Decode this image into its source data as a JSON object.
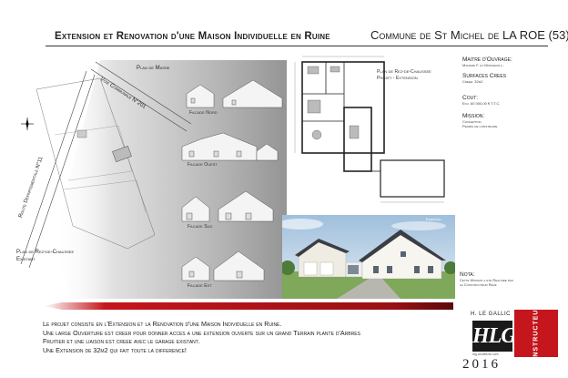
{
  "header": {
    "title": "Extension et Renovation d'une Maison Individuelle en Ruine",
    "commune": "Commune de St Michel de LA ROE (53)"
  },
  "site_plan": {
    "plan_label": "Plan de Masse",
    "road_1": "Voie Communale N°201",
    "road_2": "Route Departementale N°11",
    "existing_label": "Plan de Rez-de-Chaussee Existant"
  },
  "facades": {
    "nord": "Facade Nord",
    "ouest": "Facade Ouest",
    "sud": "Facade Sud",
    "est": "Facade Est"
  },
  "floor_plan": {
    "label_1": "Plan de Rez-de-Chaussee",
    "label_2": "Projet - Extension"
  },
  "insertion": {
    "label": "Insertion"
  },
  "sidebar": {
    "maitre_title": "Maitre d'Ouvrage:",
    "maitre_value": "Madame F. et Monsieur L.",
    "surfaces_title": "Surfaces Crees",
    "surfaces_value": "Creee: 32m2",
    "cout_title": "Cout:",
    "cout_value": "Env. 60 000,00 € T.T.C.",
    "mission_title": "Mission:",
    "mission_value_1": "Conception",
    "mission_value_2": "Permis de construire"
  },
  "nota": {
    "title": "Nota:",
    "text_1": "Cette Mission a ete Realisee par",
    "text_2": "le Constructeur Reve"
  },
  "description": {
    "line_1": "Le projet consiste en l'Extension et la Renovation d'une Maison Individuelle en Ruine.",
    "line_2": "Une large Ouverture est creer pour donner acces a une extension ouverte sur un grand Terrain plante d'Arbres",
    "line_3": "Fruitier et une liaison est creee avec le garage existant.",
    "line_4": "Une Extension de 32m2 qui fait toute la difference!"
  },
  "logo": {
    "name": "H. LE GALLIC",
    "mark": "HLG",
    "sub": "hlg-architecte.com",
    "year": "2016",
    "vertical": "CONSTRUCTEURS"
  },
  "colors": {
    "accent_red": "#c4161c",
    "ink": "#222222"
  }
}
